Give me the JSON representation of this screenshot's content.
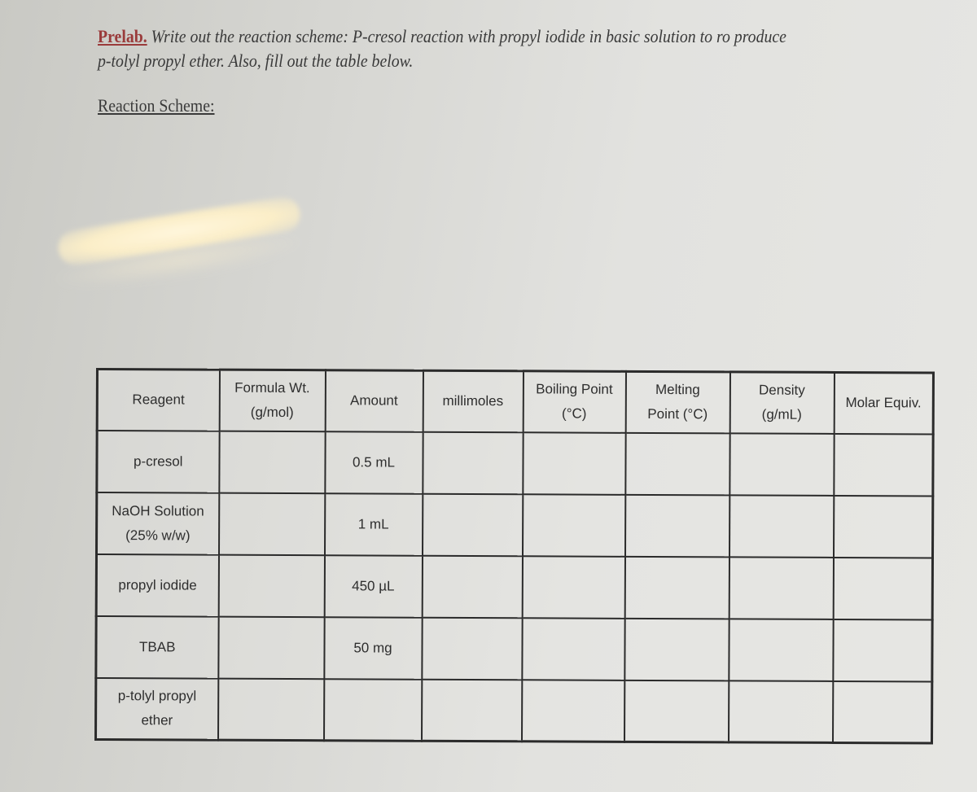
{
  "header": {
    "prelab_tag": "Prelab.",
    "instructions": " Write out the reaction scheme: P-cresol reaction with propyl iodide in basic solution to ro produce p-tolyl propyl ether.  Also, fill out the table below.",
    "reaction_scheme_label": "Reaction Scheme:"
  },
  "table": {
    "columns": [
      {
        "line1": "Reagent",
        "line2": ""
      },
      {
        "line1": "Formula Wt.",
        "line2": "(g/mol)"
      },
      {
        "line1": "Amount",
        "line2": ""
      },
      {
        "line1": "millimoles",
        "line2": ""
      },
      {
        "line1": "Boiling Point",
        "line2": "(°C)"
      },
      {
        "line1": "Melting",
        "line2": "Point (°C)"
      },
      {
        "line1": "Density",
        "line2": "(g/mL)"
      },
      {
        "line1": "Molar Equiv.",
        "line2": ""
      }
    ],
    "rows": [
      {
        "reagent_line1": "p-cresol",
        "reagent_line2": "",
        "formula_wt": "",
        "amount": "0.5 mL",
        "millimoles": "",
        "boiling_point": "",
        "melting_point": "",
        "density": "",
        "molar_equiv": ""
      },
      {
        "reagent_line1": "NaOH Solution",
        "reagent_line2": "(25% w/w)",
        "formula_wt": "",
        "amount": "1 mL",
        "millimoles": "",
        "boiling_point": "",
        "melting_point": "",
        "density": "",
        "molar_equiv": ""
      },
      {
        "reagent_line1": "propyl iodide",
        "reagent_line2": "",
        "formula_wt": "",
        "amount": "450 µL",
        "millimoles": "",
        "boiling_point": "",
        "melting_point": "",
        "density": "",
        "molar_equiv": ""
      },
      {
        "reagent_line1": "TBAB",
        "reagent_line2": "",
        "formula_wt": "",
        "amount": "50 mg",
        "millimoles": "",
        "boiling_point": "",
        "melting_point": "",
        "density": "",
        "molar_equiv": ""
      },
      {
        "reagent_line1": "p-tolyl propyl",
        "reagent_line2": "ether",
        "formula_wt": "",
        "amount": "",
        "millimoles": "",
        "boiling_point": "",
        "melting_point": "",
        "density": "",
        "molar_equiv": ""
      }
    ]
  }
}
